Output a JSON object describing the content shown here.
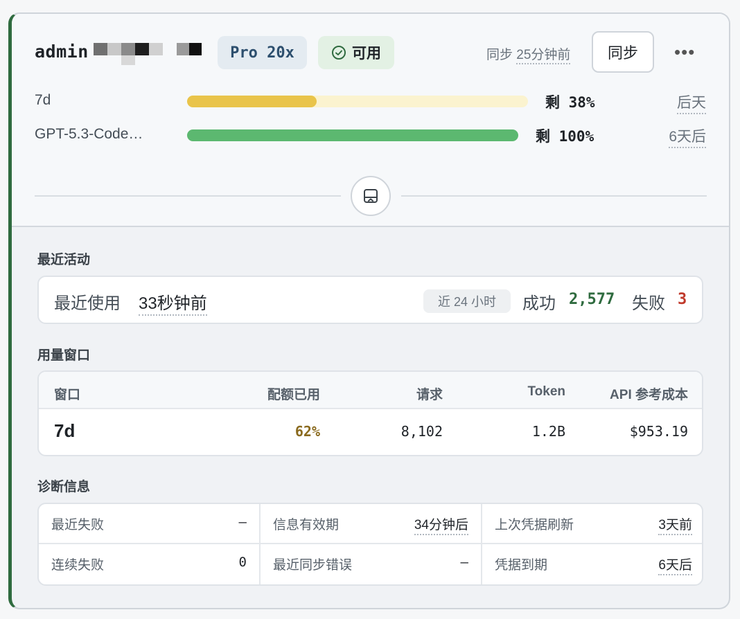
{
  "account": {
    "name": "admin",
    "plan": "Pro 20x",
    "status": "可用",
    "sync_label": "同步",
    "sync_time": "25分钟前",
    "sync_button": "同步",
    "more": "•••"
  },
  "quotas": [
    {
      "label": "7d",
      "remaining": "剩 38%",
      "reset": "后天",
      "fill_fraction": 0.38,
      "color": "#e9c44a",
      "track_color": "#fbf3cf"
    },
    {
      "label": "GPT-5.3-Code…",
      "remaining": "剩 100%",
      "reset": "6天后",
      "fill_fraction": 1.0,
      "color": "#5cb870",
      "track_color": "#dff0e2"
    }
  ],
  "activity": {
    "title": "最近活动",
    "last_used_label": "最近使用",
    "last_used_value": "33秒钟前",
    "range": "近 24 小时",
    "success_label": "成功",
    "success_value": "2,577",
    "fail_label": "失败",
    "fail_value": "3"
  },
  "usage": {
    "title": "用量窗口",
    "headers": [
      "窗口",
      "配额已用",
      "请求",
      "Token",
      "API 参考成本"
    ],
    "rows": [
      {
        "window": "7d",
        "used": "62%",
        "requests": "8,102",
        "tokens": "1.2B",
        "cost": "$953.19"
      }
    ]
  },
  "diagnostics": {
    "title": "诊断信息",
    "items": [
      {
        "key": "最近失败",
        "value": "—"
      },
      {
        "key": "信息有效期",
        "value": "34分钟后"
      },
      {
        "key": "上次凭据刷新",
        "value": "3天前"
      },
      {
        "key": "连续失败",
        "value": "0"
      },
      {
        "key": "最近同步错误",
        "value": "—"
      },
      {
        "key": "凭据到期",
        "value": "6天后"
      }
    ]
  },
  "colors": {
    "success": "#2f6b3f",
    "fail": "#c0392b",
    "used": "#8a6a1e",
    "accent_border": "#2f6b3f"
  }
}
